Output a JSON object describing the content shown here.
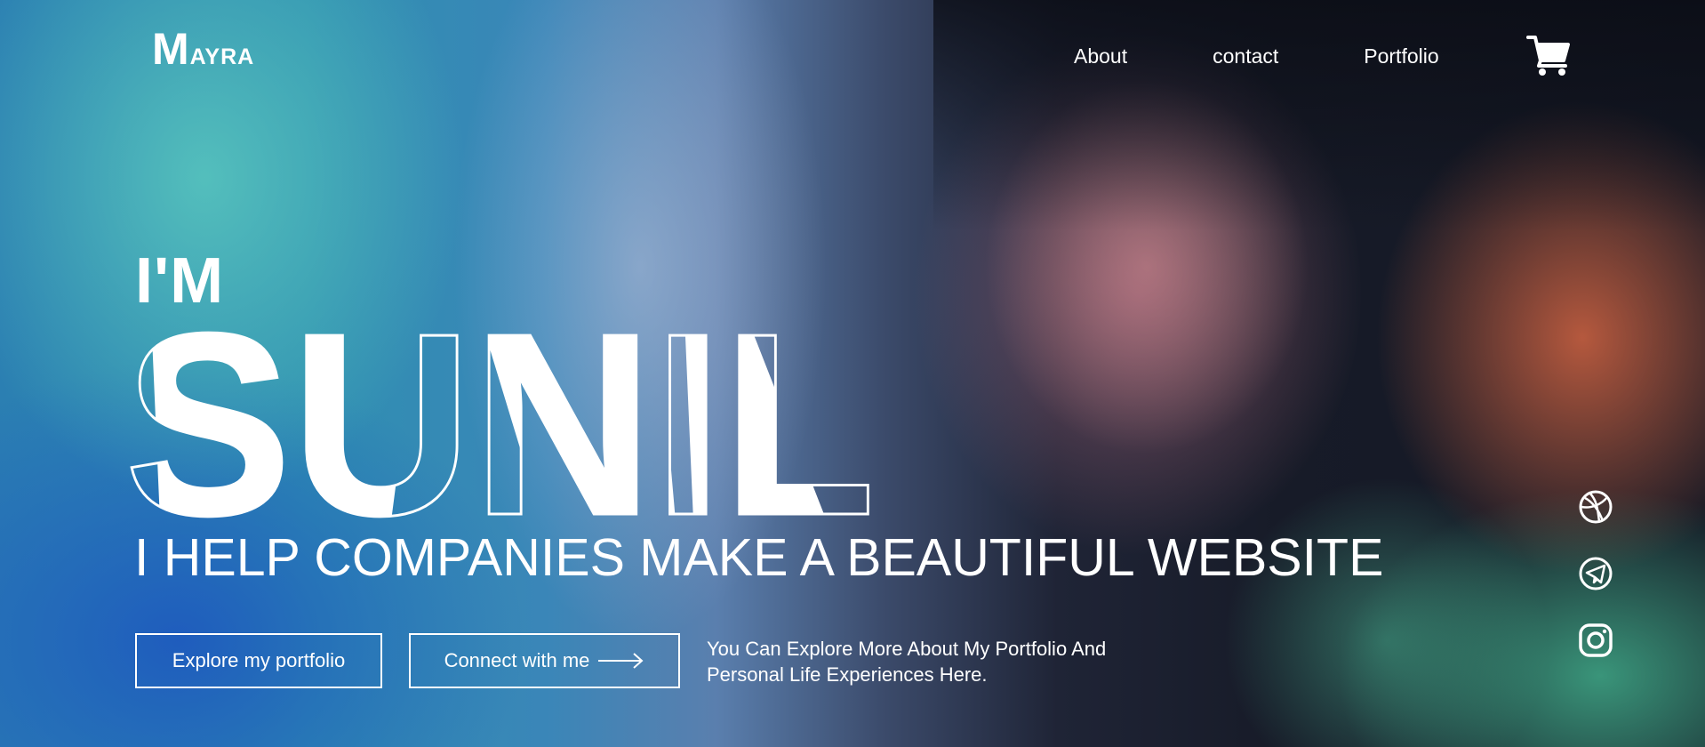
{
  "header": {
    "logo_initial": "M",
    "logo_rest": "ayra",
    "nav": [
      {
        "label": "About"
      },
      {
        "label": "contact"
      },
      {
        "label": "Portfolio"
      }
    ],
    "cart_icon": "shopping-cart-icon"
  },
  "hero": {
    "intro": "I'M",
    "name": "SUNIL",
    "tagline": "I HELP COMPANIES MAKE A BEAUTIFUL WEBSITE",
    "buttons": {
      "explore_label": "Explore my portfolio",
      "connect_label": "Connect with me"
    },
    "blurb": "You Can Explore More About My Portfolio And Personal Life Experiences Here."
  },
  "social": [
    {
      "icon": "dribbble-icon"
    },
    {
      "icon": "telegram-icon"
    },
    {
      "icon": "instagram-icon"
    }
  ],
  "colors": {
    "text": "#ffffff",
    "accent_teal": "#3fb8a4",
    "accent_orange": "#e8683f"
  }
}
